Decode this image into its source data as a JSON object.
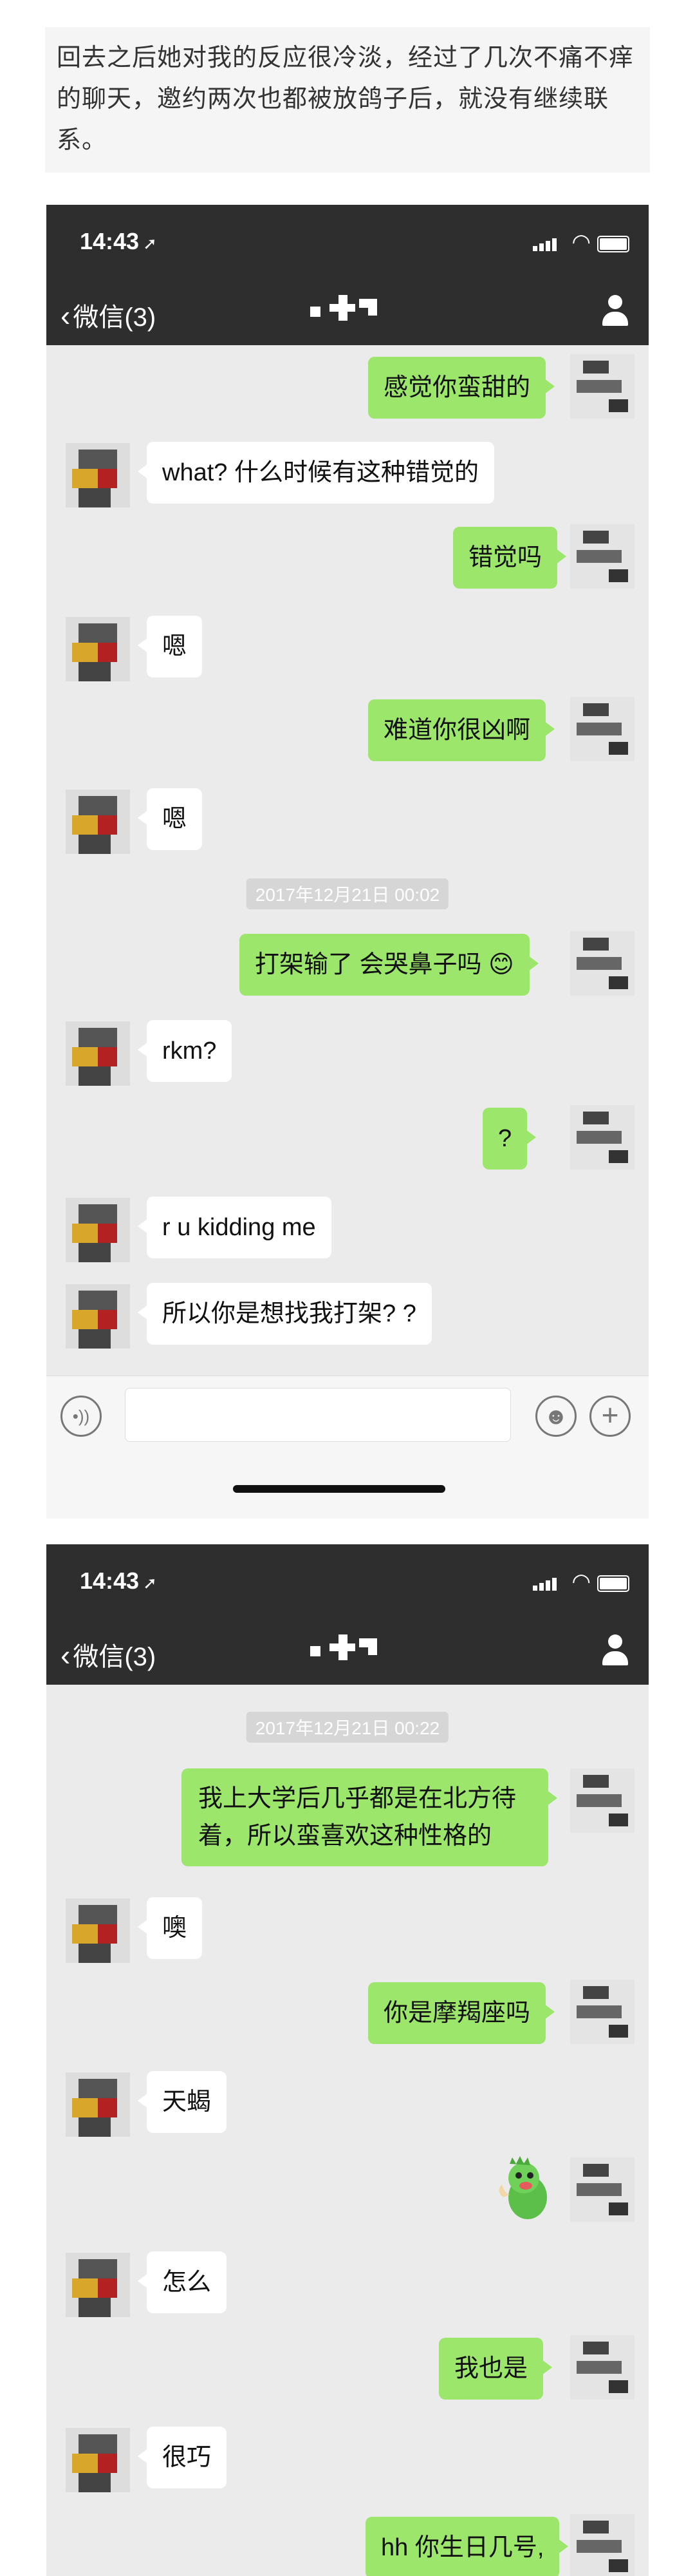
{
  "intro_text": "回去之后她对我的反应很冷淡，经过了几次不痛不痒的聊天，邀约两次也都被放鸽子后，就没有继续联系。",
  "status": {
    "time": "14:43",
    "arrow": "➚"
  },
  "nav": {
    "back_label": "微信(3)",
    "back_chevron": "‹"
  },
  "chat1": {
    "timestamp": "2017年12月21日 00:02",
    "messages": [
      {
        "side": "me",
        "text": "感觉你蛮甜的"
      },
      {
        "side": "other",
        "text": "what? 什么时候有这种错觉的"
      },
      {
        "side": "me",
        "text": "错觉吗"
      },
      {
        "side": "other",
        "text": "嗯"
      },
      {
        "side": "me",
        "text": "难道你很凶啊"
      },
      {
        "side": "other",
        "text": "嗯"
      },
      {
        "side": "me",
        "text": "打架输了 会哭鼻子吗 😊"
      },
      {
        "side": "other",
        "text": "rkm?"
      },
      {
        "side": "me",
        "text": "?"
      },
      {
        "side": "other",
        "text": "r u kidding me"
      },
      {
        "side": "other",
        "text": "所以你是想找我打架? ?"
      }
    ]
  },
  "input": {
    "voice_icon": "•))",
    "emoji_icon": "☻",
    "plus_icon": "+"
  },
  "chat2": {
    "timestamp": "2017年12月21日 00:22",
    "messages": [
      {
        "side": "me",
        "text": "我上大学后几乎都是在北方待着，所以蛮喜欢这种性格的"
      },
      {
        "side": "other",
        "text": "噢"
      },
      {
        "side": "me",
        "text": "你是摩羯座吗"
      },
      {
        "side": "other",
        "text": "天蝎"
      },
      {
        "side": "me",
        "text": ""
      },
      {
        "side": "other",
        "text": "怎么"
      },
      {
        "side": "me",
        "text": "我也是"
      },
      {
        "side": "other",
        "text": "很巧"
      },
      {
        "side": "me",
        "text": "hh 你生日几号,"
      }
    ]
  },
  "colors": {
    "me_bubble": "#9ce66b",
    "other_bubble": "#ffffff",
    "topbar": "#2e2e2e",
    "chat_bg": "#ebebeb"
  }
}
